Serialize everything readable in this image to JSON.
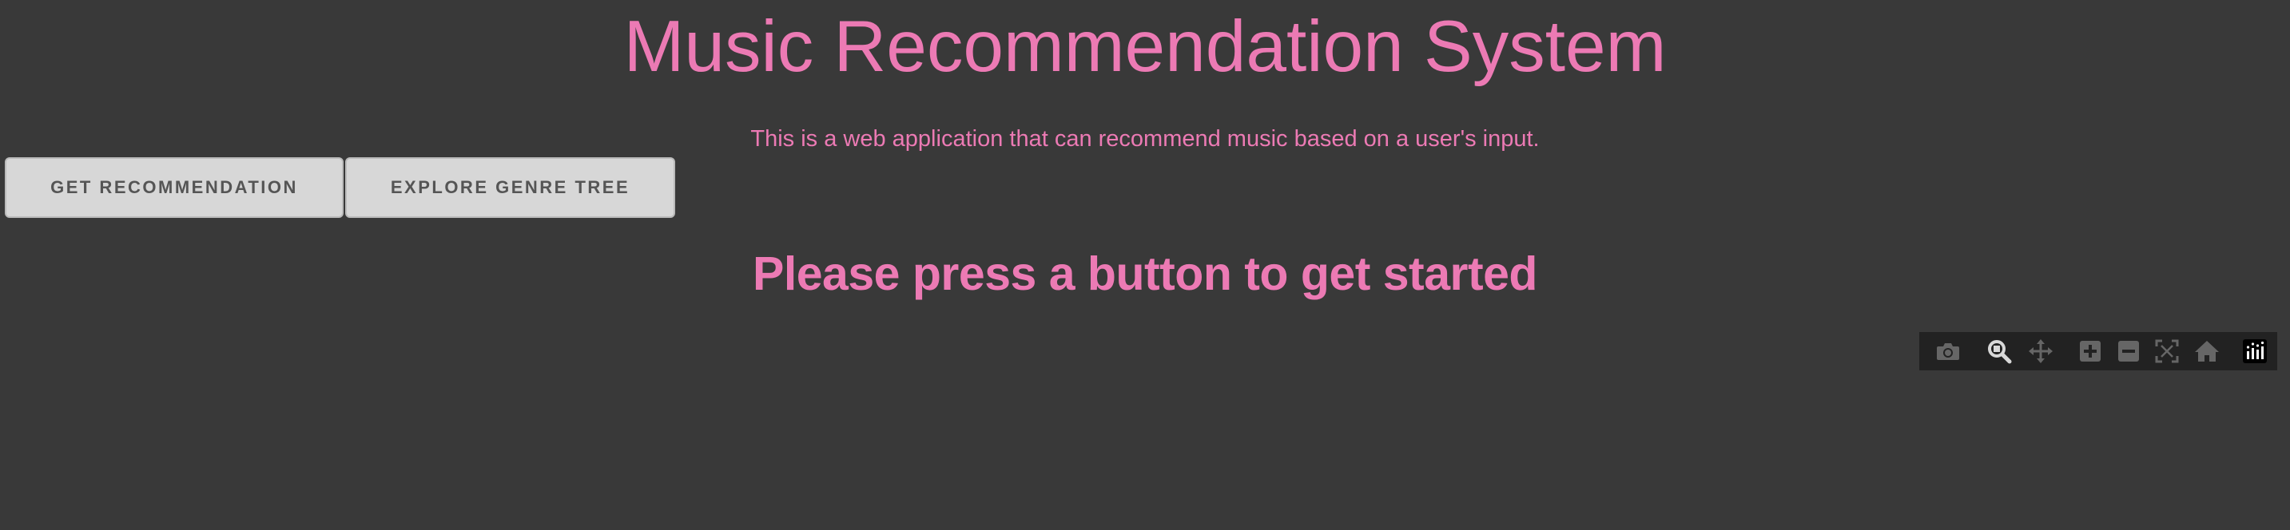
{
  "header": {
    "title": "Music Recommendation System",
    "subtitle": "This is a web application that can recommend music based on a user's input."
  },
  "buttons": {
    "get_recommendation": "GET RECOMMENDATION",
    "explore_genre_tree": "EXPLORE GENRE TREE"
  },
  "main": {
    "prompt": "Please press a button to get started"
  },
  "modebar": {
    "icons": [
      "camera-icon",
      "zoom-icon",
      "pan-icon",
      "zoom-in-icon",
      "zoom-out-icon",
      "autoscale-icon",
      "reset-axes-home-icon",
      "plotly-logo-icon"
    ],
    "active_icon": "zoom-icon"
  },
  "colors": {
    "background": "#393939",
    "accent_pink": "#ec7ab4",
    "button_bg": "#d7d7d7",
    "button_text": "#555555",
    "modebar_bg": "#222222",
    "modebar_icon": "#666666",
    "modebar_icon_active": "#d8d8d8"
  }
}
